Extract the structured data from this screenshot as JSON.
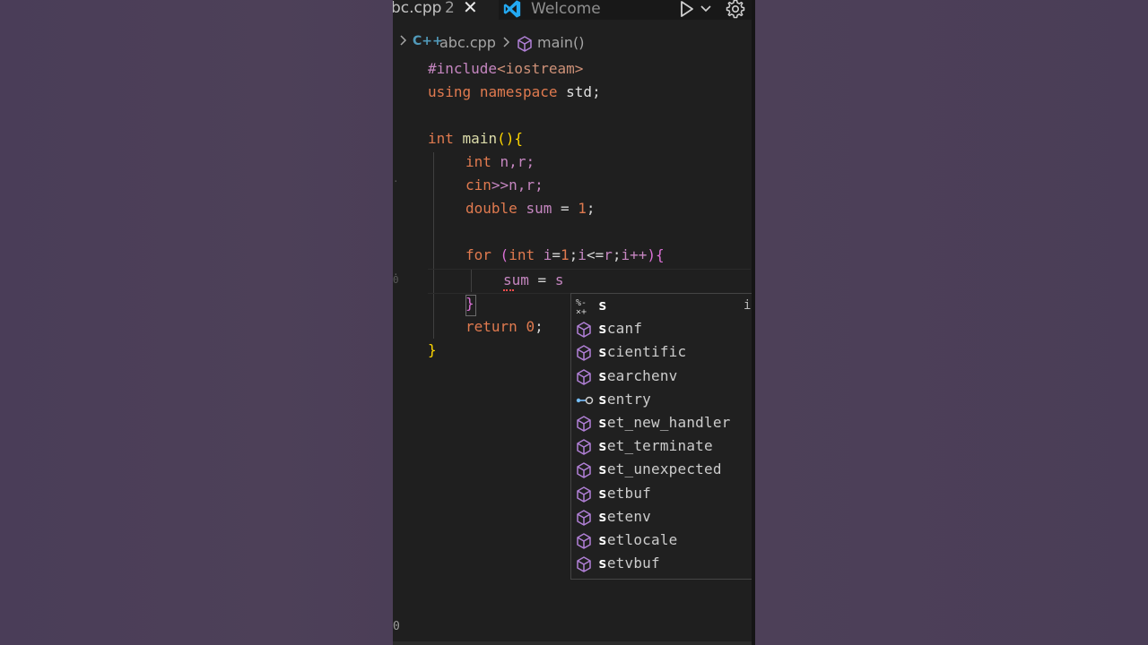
{
  "tabs": [
    {
      "label": "bc.cpp",
      "problems": "2",
      "active": true
    },
    {
      "label": "Welcome",
      "active": false
    }
  ],
  "breadcrumb": {
    "lang": "C++",
    "file": "abc.cpp",
    "symbol": "main()"
  },
  "code": {
    "l1_dir": "#include",
    "l1_hdr": "<iostream>",
    "l2_using": "using",
    "l2_ns": "namespace",
    "l2_std": "std",
    "l2_semi": ";",
    "l3_int": "int",
    "l3_main": "main",
    "l3_paren": "()",
    "l3_brace": "{",
    "l4_int": "int",
    "l4_rest": "n,r;",
    "l5_cin": "cin",
    "l5_op": ">>",
    "l5_rest": "n,r;",
    "l6_double": "double",
    "l6_sum": "sum",
    "l6_eq": " = ",
    "l6_num": "1",
    "l6_semi": ";",
    "l7_for": "for",
    "l7_open": "(",
    "l7_int": "int",
    "l7_i1": "i",
    "l7_eq": "=",
    "l7_one": "1",
    "l7_s1": ";",
    "l7_i2": "i",
    "l7_le": "<=",
    "l7_r": "r",
    "l7_s2": ";",
    "l7_i3": "i",
    "l7_pp": "++",
    "l7_close": ")",
    "l7_brace": "{",
    "l8_sum": "sum",
    "l8_eq": " = ",
    "l8_s": "s",
    "l9_brace": "}",
    "l10_return": "return",
    "l10_num": "0",
    "l10_semi": ";",
    "l11_brace": "}"
  },
  "suggestions": [
    {
      "match": "s",
      "rest": "",
      "kind": "snippet",
      "info": "i"
    },
    {
      "match": "s",
      "rest": "canf",
      "kind": "method"
    },
    {
      "match": "s",
      "rest": "cientific",
      "kind": "method"
    },
    {
      "match": "s",
      "rest": "earchenv",
      "kind": "method"
    },
    {
      "match": "s",
      "rest": "entry",
      "kind": "reference"
    },
    {
      "match": "s",
      "rest": "et_new_handler",
      "kind": "method"
    },
    {
      "match": "s",
      "rest": "et_terminate",
      "kind": "method"
    },
    {
      "match": "s",
      "rest": "et_unexpected",
      "kind": "method"
    },
    {
      "match": "s",
      "rest": "etbuf",
      "kind": "method"
    },
    {
      "match": "s",
      "rest": "etenv",
      "kind": "method"
    },
    {
      "match": "s",
      "rest": "etlocale",
      "kind": "method"
    },
    {
      "match": "s",
      "rest": "etvbuf",
      "kind": "method"
    }
  ],
  "status": {
    "problems": "0"
  },
  "colors": {
    "method_icon": "#b180d7",
    "vscode_blue": "#23a9f2",
    "cpp_blue": "#519aba"
  }
}
